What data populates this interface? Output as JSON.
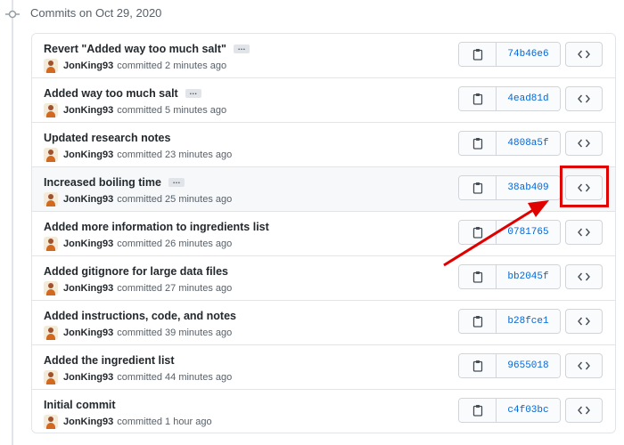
{
  "group": {
    "title": "Commits on Oct 29, 2020"
  },
  "commits": [
    {
      "message": "Revert \"Added way too much salt\"",
      "has_ellipsis": true,
      "author": "JonKing93",
      "time": "committed 2 minutes ago",
      "sha": "74b46e6"
    },
    {
      "message": "Added way too much salt",
      "has_ellipsis": true,
      "author": "JonKing93",
      "time": "committed 5 minutes ago",
      "sha": "4ead81d"
    },
    {
      "message": "Updated research notes",
      "has_ellipsis": false,
      "author": "JonKing93",
      "time": "committed 23 minutes ago",
      "sha": "4808a5f"
    },
    {
      "message": "Increased boiling time",
      "has_ellipsis": true,
      "author": "JonKing93",
      "time": "committed 25 minutes ago",
      "sha": "38ab409"
    },
    {
      "message": "Added more information to ingredients list",
      "has_ellipsis": false,
      "author": "JonKing93",
      "time": "committed 26 minutes ago",
      "sha": "0781765"
    },
    {
      "message": "Added gitignore for large data files",
      "has_ellipsis": false,
      "author": "JonKing93",
      "time": "committed 27 minutes ago",
      "sha": "bb2045f"
    },
    {
      "message": "Added instructions, code, and notes",
      "has_ellipsis": false,
      "author": "JonKing93",
      "time": "committed 39 minutes ago",
      "sha": "b28fce1"
    },
    {
      "message": "Added the ingredient list",
      "has_ellipsis": false,
      "author": "JonKing93",
      "time": "committed 44 minutes ago",
      "sha": "9655018"
    },
    {
      "message": "Initial commit",
      "has_ellipsis": false,
      "author": "JonKing93",
      "time": "committed 1 hour ago",
      "sha": "c4f03bc"
    }
  ],
  "ellipsis_label": "…",
  "annotation": {
    "highlighted_row": 3,
    "box_color": "#e00000",
    "arrow_color": "#e00000"
  },
  "icons": {
    "copy": "clipboard-icon",
    "browse": "code-icon",
    "timeline": "commit-icon",
    "avatar": "avatar-icon"
  }
}
